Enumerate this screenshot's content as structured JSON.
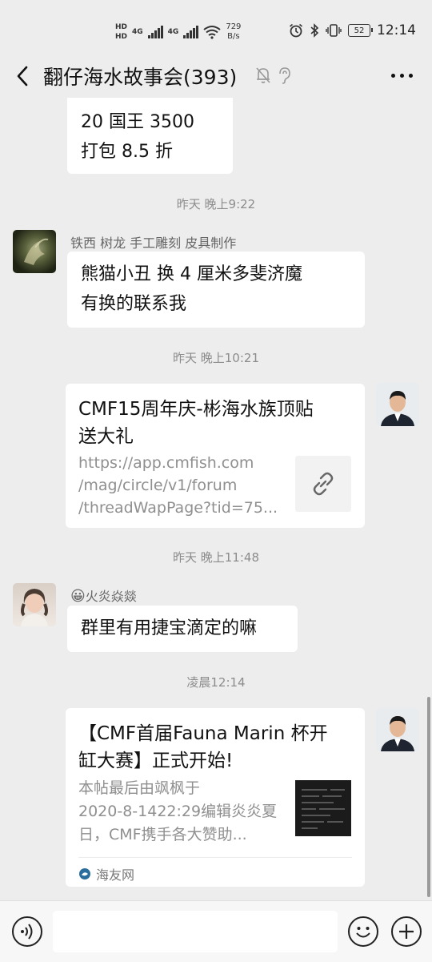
{
  "status_bar": {
    "hd_top": "HD",
    "hd_bottom": "HD",
    "net1": "4G",
    "net2": "4G",
    "speed_value": "729",
    "speed_unit": "B/s",
    "battery": "52",
    "time": "12:14"
  },
  "header": {
    "title": "翻仔海水故事会(393)"
  },
  "messages": {
    "m1": {
      "line1": "20 国王 3500",
      "line2": "打包 8.5 折"
    },
    "t1": "昨天 晚上9:22",
    "m2": {
      "sender": "铁西  树龙  手工雕刻  皮具制作",
      "line1": "熊猫小丑  换 4 厘米多斐济魔",
      "line2": "有换的联系我"
    },
    "t2": "昨天 晚上10:21",
    "m3": {
      "title_line1": "CMF15周年庆-彬海水族顶贴",
      "title_line2": "送大礼",
      "desc_line1": "https://app.cmfish.com",
      "desc_line2": "/mag/circle/v1/forum",
      "desc_line3": "/threadWapPage?tid=75..."
    },
    "t3": "昨天 晚上11:48",
    "m4": {
      "sender_emoji": "😀",
      "sender": "火炎焱燚",
      "text": "群里有用捷宝滴定的嘛"
    },
    "t4": "凌晨12:14",
    "m5": {
      "title_line1": "【CMF首届Fauna Marin 杯开",
      "title_line2": "缸大赛】正式开始!",
      "desc_line1": "本帖最后由飒枫于",
      "desc_line2": "2020-8-1422:29编辑炎炎夏",
      "desc_line3": "日，CMF携手各大赞助...",
      "source": "海友网"
    }
  },
  "input": {
    "value": ""
  },
  "icons": {
    "back": "back-arrow-icon",
    "mute": "mute-bell-icon",
    "ear": "ear-icon",
    "more": "more-dots-icon",
    "link": "link-icon",
    "voice": "voice-icon",
    "emoji": "emoji-icon",
    "plus": "plus-icon"
  }
}
